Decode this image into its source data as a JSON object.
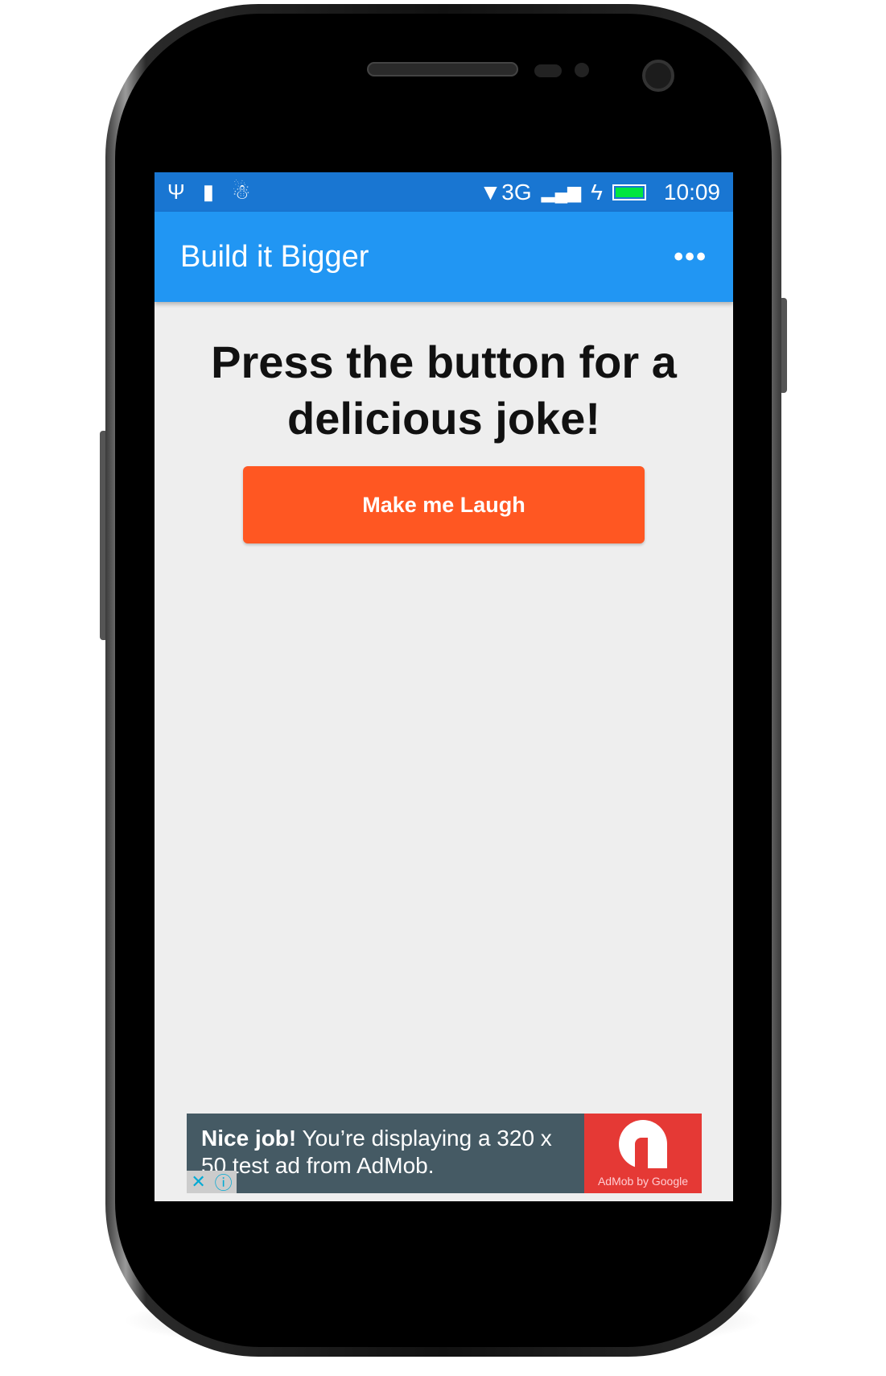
{
  "status_bar": {
    "time": "10:09",
    "network": "3G",
    "icons": [
      "usb-icon",
      "sim-alert-icon",
      "android-debug-icon",
      "wifi-icon",
      "signal-icon",
      "charging-icon",
      "battery-icon"
    ],
    "battery_color": "#00e640"
  },
  "app_bar": {
    "title": "Build it Bigger",
    "more_label": "•••"
  },
  "main": {
    "heading": "Press the button for a delicious joke!",
    "button_label": "Make me Laugh",
    "button_color": "#ff5722"
  },
  "ad": {
    "headline": "Nice job!",
    "body": " You’re displaying a 320 x 50 test ad from AdMob.",
    "brand": "AdMob by Google",
    "close_glyph": "✕",
    "info_glyph": "ⓘ"
  }
}
